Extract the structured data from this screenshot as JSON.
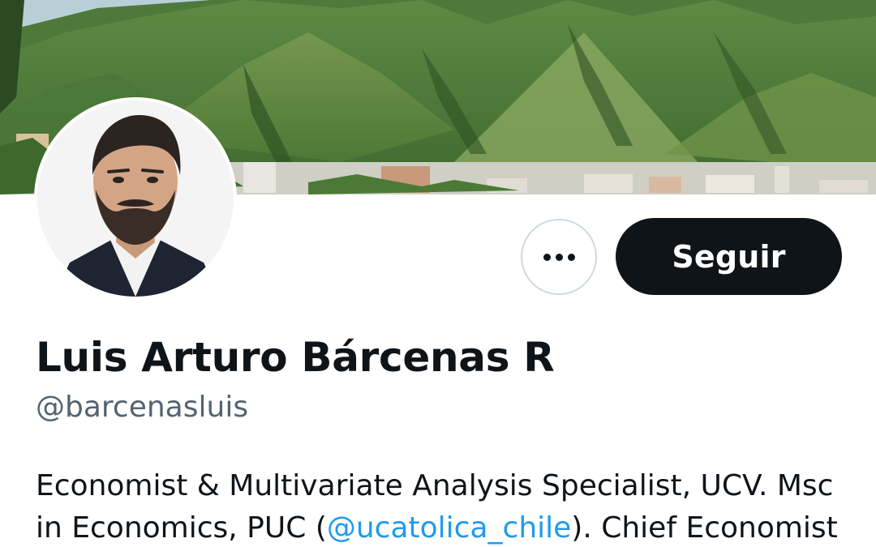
{
  "colors": {
    "text_primary": "#0f1419",
    "text_secondary": "#536471",
    "link": "#1d9bf0",
    "follow_button_bg": "#0f1419",
    "follow_button_text": "#ffffff",
    "border": "#cfd9de"
  },
  "profile": {
    "display_name": "Luis Arturo Bárcenas R",
    "handle": "@barcenasluis",
    "bio": {
      "line1": "Economist & Multivariate Analysis Specialist, UCV. Msc",
      "line2_prefix": "in Economics, PUC (",
      "line2_mention": "@ucatolica_chile",
      "line2_suffix": "). Chief Economist"
    }
  },
  "actions": {
    "more_icon": "more-horizontal-icon",
    "follow_label": "Seguir"
  }
}
